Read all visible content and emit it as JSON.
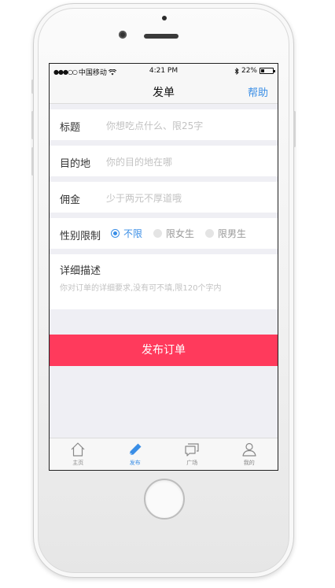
{
  "status": {
    "carrier": "中国移动",
    "time": "4:21 PM",
    "battery": "22%",
    "battery_level": 0.22
  },
  "nav": {
    "title": "发单",
    "help": "帮助"
  },
  "form": {
    "title_label": "标题",
    "title_placeholder": "你想吃点什么、限25字",
    "dest_label": "目的地",
    "dest_placeholder": "你的目的地在哪",
    "fee_label": "佣金",
    "fee_placeholder": "少于两元不厚道哦",
    "gender_label": "性别限制",
    "gender_options": [
      "不限",
      "限女生",
      "限男生"
    ],
    "gender_selected": "不限",
    "desc_label": "详细描述",
    "desc_placeholder": "你对订单的详细要求,没有可不填,限120个字内"
  },
  "submit_label": "发布订单",
  "tabs": [
    {
      "label": "主页",
      "icon": "home-icon"
    },
    {
      "label": "发布",
      "icon": "pencil-icon"
    },
    {
      "label": "广场",
      "icon": "chat-icon"
    },
    {
      "label": "我的",
      "icon": "user-icon"
    }
  ],
  "colors": {
    "accent": "#3a8ee6",
    "submit": "#ff3a5c"
  }
}
